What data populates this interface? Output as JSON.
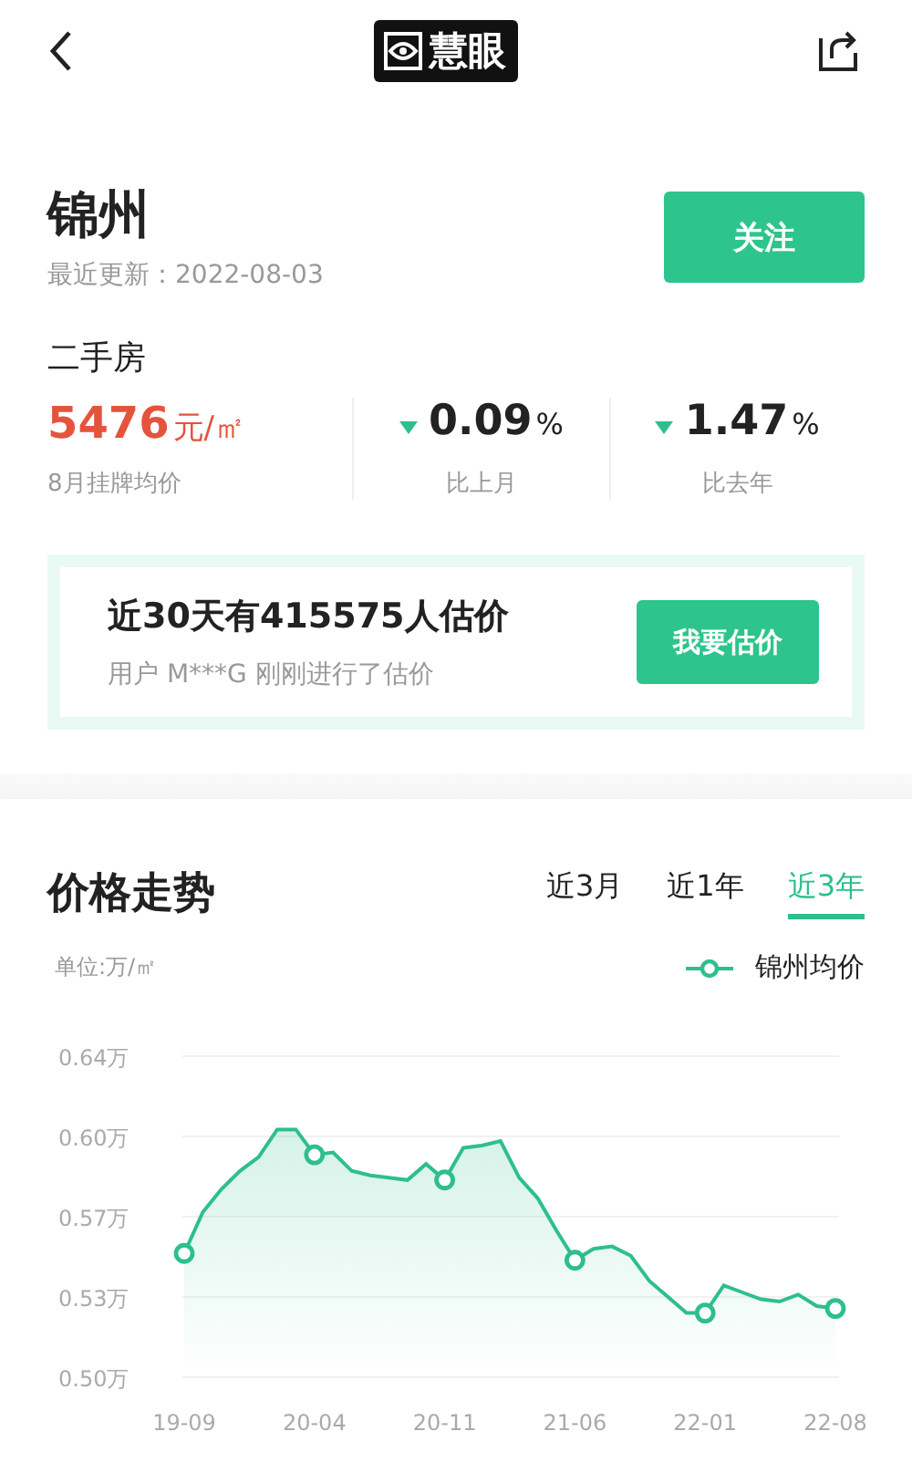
{
  "header": {
    "logo_text": "慧眼"
  },
  "city": {
    "name": "锦州",
    "updated": "最近更新：2022-08-03",
    "follow_button": "关注"
  },
  "market": {
    "title": "二手房",
    "price": {
      "value": "5476",
      "unit": "元/㎡",
      "caption": "8月挂牌均价"
    },
    "changes": [
      {
        "falling": true,
        "value": "0.09",
        "unit": "%",
        "caption": "比上月"
      },
      {
        "falling": true,
        "value": "1.47",
        "unit": "%",
        "caption": "比去年"
      }
    ]
  },
  "estimate": {
    "headline": "近30天有415575人估价",
    "note": "用户 M***G 刚刚进行了估价",
    "button": "我要估价"
  },
  "trend": {
    "title": "价格走势",
    "tabs": [
      {
        "label": "近3月",
        "selected": false
      },
      {
        "label": "近1年",
        "selected": false
      },
      {
        "label": "近3年",
        "selected": true
      }
    ],
    "unit": "单位:万/㎡",
    "chart_data": {
      "type": "area",
      "grid": true,
      "categories": [
        "19-09",
        null,
        null,
        null,
        null,
        null,
        null,
        "20-04",
        null,
        null,
        null,
        null,
        null,
        null,
        "20-11",
        null,
        null,
        null,
        null,
        null,
        null,
        "21-06",
        null,
        null,
        null,
        null,
        null,
        null,
        "22-01",
        null,
        null,
        null,
        null,
        null,
        null,
        "22-08"
      ],
      "series": [
        {
          "name": "锦州均价",
          "color": "#2dbf8c",
          "values": [
            0.554,
            0.572,
            0.582,
            0.59,
            0.596,
            0.608,
            0.608,
            0.597,
            0.598,
            0.59,
            0.588,
            0.587,
            0.586,
            0.593,
            0.586,
            0.6,
            0.601,
            0.603,
            0.587,
            0.578,
            0.564,
            0.551,
            0.556,
            0.557,
            0.553,
            0.542,
            0.535,
            0.528,
            0.528,
            0.54,
            0.537,
            0.534,
            0.533,
            0.536,
            0.531,
            0.53
          ]
        }
      ],
      "ylim": [
        0.5,
        0.64
      ],
      "yticks": [
        {
          "value": 0.5,
          "label": "0.50万"
        },
        {
          "value": 0.535,
          "label": "0.53万"
        },
        {
          "value": 0.57,
          "label": "0.57万"
        },
        {
          "value": 0.605,
          "label": "0.60万"
        },
        {
          "value": 0.64,
          "label": "0.64万"
        }
      ]
    }
  }
}
